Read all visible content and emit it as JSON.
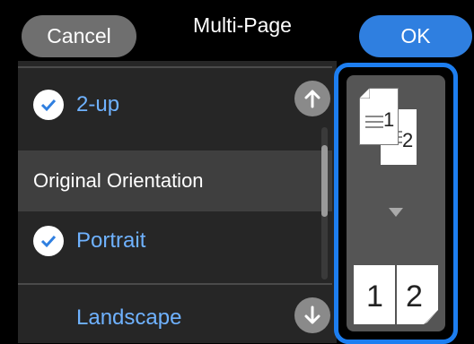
{
  "header": {
    "cancel_label": "Cancel",
    "title": "Multi-Page",
    "ok_label": "OK"
  },
  "list": {
    "items": [
      {
        "label": "2-up",
        "checked": true
      },
      {
        "label": "Original Orientation",
        "is_header": true
      },
      {
        "label": "Portrait",
        "checked": true
      },
      {
        "label": "Landscape",
        "checked": false
      }
    ]
  },
  "preview": {
    "top_numbers": [
      "1",
      "2"
    ],
    "bottom_numbers": [
      "1",
      "2"
    ]
  },
  "colors": {
    "accent": "#2f7fe0",
    "highlight_border": "#1d7ef0",
    "label_blue": "#6fb2ff",
    "cancel_bg": "#6f6f6f"
  },
  "icons": {
    "check": "check-circle-icon",
    "scroll_up": "arrow-up-icon",
    "scroll_down": "arrow-down-icon",
    "arrow": "triangle-down-icon"
  }
}
